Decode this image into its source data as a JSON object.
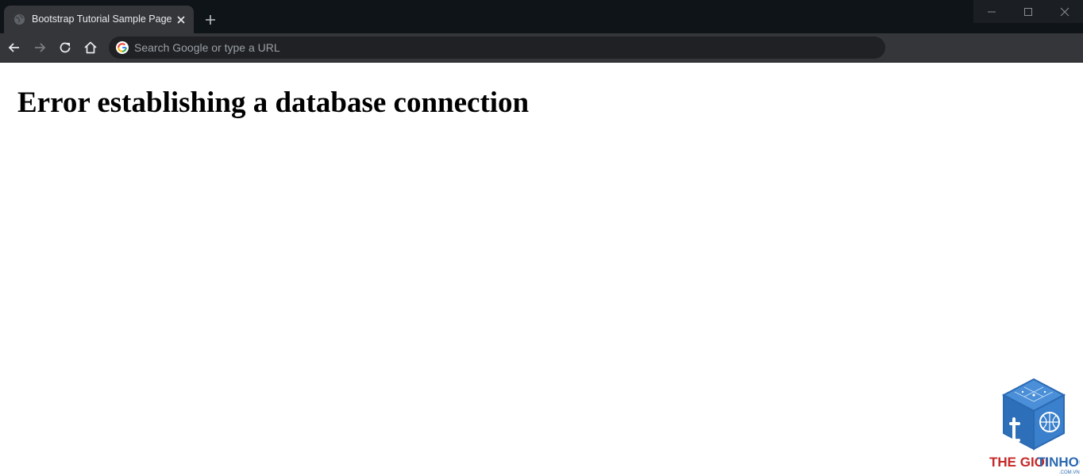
{
  "browser": {
    "tab": {
      "title": "Bootstrap Tutorial Sample Page",
      "favicon_icon": "globe-icon",
      "close_icon": "close-icon"
    },
    "new_tab_icon": "plus-icon",
    "window_controls": {
      "minimize_icon": "minimize-icon",
      "maximize_icon": "maximize-icon",
      "close_icon": "window-close-icon"
    },
    "toolbar": {
      "back_icon": "arrow-left-icon",
      "forward_icon": "arrow-right-icon",
      "reload_icon": "reload-icon",
      "home_icon": "home-icon"
    },
    "omnibox": {
      "placeholder": "Search Google or type a URL",
      "value": "",
      "search_engine_icon": "google-icon"
    }
  },
  "page": {
    "heading": "Error establishing a database connection"
  },
  "watermark": {
    "brand_red": "THE GIOI",
    "brand_blue": "TINHOC",
    "domain": ".COM.VN"
  },
  "colors": {
    "tabstrip_bg": "#0f1419",
    "toolbar_bg": "#35363a",
    "omnibox_bg": "#202124",
    "watermark_red": "#c62828",
    "watermark_blue": "#2a6ab3"
  }
}
